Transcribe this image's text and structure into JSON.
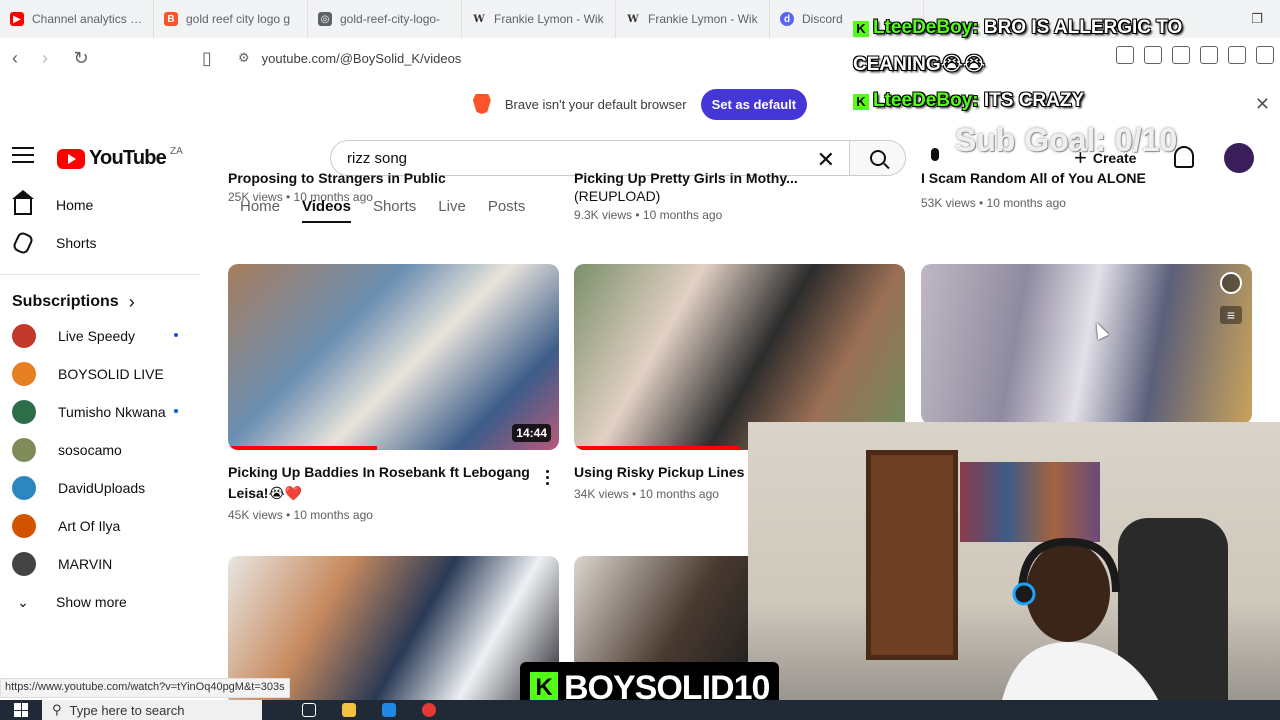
{
  "browser": {
    "tabs": [
      {
        "label": "Channel analytics - Y",
        "icon": "youtube-studio-icon",
        "color": "#ff0000"
      },
      {
        "label": "gold reef city logo g",
        "icon": "brave-icon",
        "color": "#fb542b"
      },
      {
        "label": "gold-reef-city-logo-",
        "icon": "globe-icon",
        "color": "#5f6368"
      },
      {
        "label": "Frankie Lymon - Wik",
        "icon": "wikipedia-icon",
        "color": "#333333"
      },
      {
        "label": "Frankie Lymon - Wik",
        "icon": "wikipedia-icon",
        "color": "#333333"
      },
      {
        "label": "Discord",
        "icon": "discord-icon",
        "color": "#5865f2"
      }
    ],
    "address": "youtube.com/@BoySolid_K/videos",
    "banner_text": "Brave isn't your default browser",
    "banner_button": "Set as default"
  },
  "youtube": {
    "country": "ZA",
    "logo_text": "YouTube",
    "search_value": "rizz song",
    "create_label": "Create",
    "sidebar": {
      "nav": [
        {
          "label": "Home",
          "icon": "home-icon"
        },
        {
          "label": "Shorts",
          "icon": "shorts-icon"
        }
      ],
      "subscriptions_label": "Subscriptions",
      "channels": [
        {
          "name": "Live Speedy",
          "color": "#c0392b",
          "new": true
        },
        {
          "name": "BOYSOLID LIVE",
          "color": "#e67e22",
          "new": false
        },
        {
          "name": "Tumisho Nkwana",
          "color": "#2c6e49",
          "new": true
        },
        {
          "name": "sosocamo",
          "color": "#7f8c5a",
          "new": false
        },
        {
          "name": "DavidUploads",
          "color": "#2e86c1",
          "new": false
        },
        {
          "name": "Art Of Ilya",
          "color": "#d35400",
          "new": false
        },
        {
          "name": "MARVIN",
          "color": "#444444",
          "new": false
        }
      ],
      "show_more": "Show more"
    },
    "channel_tabs": [
      "Home",
      "Videos",
      "Shorts",
      "Live",
      "Posts"
    ],
    "active_tab": "Videos",
    "top_row": [
      {
        "title": "Proposing to Strangers in Public",
        "meta": "25K views • 10 months ago"
      },
      {
        "title": "Picking Up Pretty Girls in Mothy...",
        "title2": "(REUPLOAD)",
        "meta": "9.3K views • 10 months ago"
      },
      {
        "title": "I Scam Random All of You ALONE",
        "meta": "53K views • 10 months ago"
      }
    ],
    "videos": [
      {
        "title": "Picking Up Baddies In Rosebank ft Lebogang Leisa!😭❤️",
        "meta": "45K views • 10 months ago",
        "duration": "14:44",
        "progress": 0.45
      },
      {
        "title": "Using Risky Pickup Lines",
        "meta": "34K views • 10 months ago",
        "duration": "",
        "progress": 0.5
      },
      {
        "title": "",
        "meta": "",
        "duration": "",
        "progress": 0
      }
    ]
  },
  "stream": {
    "chat": [
      {
        "user": "LteeDeBoy:",
        "text": "BRO IS ALLERGIC TO"
      },
      {
        "user": "",
        "text": "CEANING😭😭"
      },
      {
        "user": "LteeDeBoy:",
        "text": "ITS CRAZY"
      }
    ],
    "sub_goal": "Sub Goal: 0/10",
    "streamer": "BOYSOLID10"
  },
  "status_url": "https://www.youtube.com/watch?v=tYinOq40pgM&t=303s",
  "taskbar": {
    "search_placeholder": "Type here to search"
  }
}
